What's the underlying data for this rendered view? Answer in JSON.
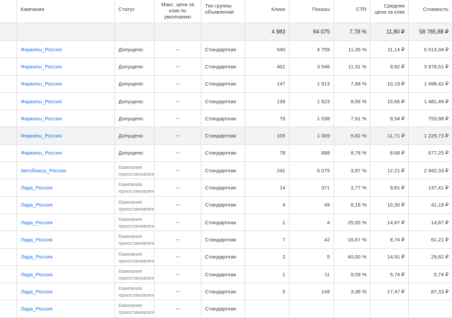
{
  "headers": {
    "campaign": "Кампания",
    "status": "Статус",
    "bid": "Макс. цена за клик по умолчанию",
    "type": "Тип группы объявлений",
    "clicks": "Клики",
    "impressions": "Показы",
    "ctr": "CTR",
    "cpc": "Средняя цена за клик",
    "cost": "Стоимость"
  },
  "totals": {
    "clicks": "4 983",
    "impressions": "64 075",
    "ctr": "7,78 %",
    "cpc": "11,80 ₽",
    "cost": "58 785,88 ₽"
  },
  "rows": [
    {
      "campaign": "Фаркопы_Россия",
      "status": "Допущено",
      "bid": "–",
      "type": "Стандартная",
      "clicks": "540",
      "impressions": "4 759",
      "ctr": "11,35 %",
      "cpc": "11,14 ₽",
      "cost": "6 013,34 ₽"
    },
    {
      "campaign": "Фаркопы_Россия",
      "status": "Допущено",
      "bid": "–",
      "type": "Стандартная",
      "clicks": "401",
      "impressions": "3 546",
      "ctr": "11,31 %",
      "cpc": "9,92 ₽",
      "cost": "3 978,51 ₽"
    },
    {
      "campaign": "Фаркопы_Россия",
      "status": "Допущено",
      "bid": "–",
      "type": "Стандартная",
      "clicks": "147",
      "impressions": "1 913",
      "ctr": "7,68 %",
      "cpc": "10,19 ₽",
      "cost": "1 498,42 ₽"
    },
    {
      "campaign": "Фаркопы_Россия",
      "status": "Допущено",
      "bid": "–",
      "type": "Стандартная",
      "clicks": "139",
      "impressions": "1 623",
      "ctr": "8,56 %",
      "cpc": "10,66 ₽",
      "cost": "1 481,48 ₽"
    },
    {
      "campaign": "Фаркопы_Россия",
      "status": "Допущено",
      "bid": "–",
      "type": "Стандартная",
      "clicks": "79",
      "impressions": "1 038",
      "ctr": "7,61 %",
      "cpc": "9,54 ₽",
      "cost": "753,98 ₽"
    },
    {
      "campaign": "Фаркопы_Россия",
      "status": "Допущено",
      "bid": "–",
      "type": "Стандартная",
      "clicks": "105",
      "impressions": "1 069",
      "ctr": "9,82 %",
      "cpc": "11,71 ₽",
      "cost": "1 229,73 ₽"
    },
    {
      "campaign": "Фаркопы_Россия",
      "status": "Допущено",
      "bid": "–",
      "type": "Стандартная",
      "clicks": "78",
      "impressions": "888",
      "ctr": "8,78 %",
      "cpc": "8,68 ₽",
      "cost": "677,25 ₽"
    },
    {
      "campaign": "Автобоксы_Россия",
      "status": "Кампания приостановлена",
      "bid": "–",
      "type": "Стандартная",
      "clicks": "241",
      "impressions": "6 075",
      "ctr": "3,97 %",
      "cpc": "12,21 ₽",
      "cost": "2 942,33 ₽"
    },
    {
      "campaign": "Лада_Россия",
      "status": "Кампания приостановлена",
      "bid": "–",
      "type": "Стандартная",
      "clicks": "14",
      "impressions": "371",
      "ctr": "3,77 %",
      "cpc": "9,81 ₽",
      "cost": "137,41 ₽"
    },
    {
      "campaign": "Лада_Россия",
      "status": "Кампания приостановлена",
      "bid": "–",
      "type": "Стандартная",
      "clicks": "4",
      "impressions": "49",
      "ctr": "8,16 %",
      "cpc": "10,30 ₽",
      "cost": "41,19 ₽"
    },
    {
      "campaign": "Лада_Россия",
      "status": "Кампания приостановлена",
      "bid": "–",
      "type": "Стандартная",
      "clicks": "1",
      "impressions": "4",
      "ctr": "25,00 %",
      "cpc": "14,87 ₽",
      "cost": "14,87 ₽"
    },
    {
      "campaign": "Лада_Россия",
      "status": "Кампания приостановлена",
      "bid": "–",
      "type": "Стандартная",
      "clicks": "7",
      "impressions": "42",
      "ctr": "16,67 %",
      "cpc": "8,74 ₽",
      "cost": "61,21 ₽"
    },
    {
      "campaign": "Лада_Россия",
      "status": "Кампания приостановлена",
      "bid": "–",
      "type": "Стандартная",
      "clicks": "2",
      "impressions": "5",
      "ctr": "40,00 %",
      "cpc": "14,91 ₽",
      "cost": "29,82 ₽"
    },
    {
      "campaign": "Лада_Россия",
      "status": "Кампания приостановлена",
      "bid": "–",
      "type": "Стандартная",
      "clicks": "1",
      "impressions": "11",
      "ctr": "9,09 %",
      "cpc": "5,74 ₽",
      "cost": "5,74 ₽"
    },
    {
      "campaign": "Лада_Россия",
      "status": "Кампания приостановлена",
      "bid": "–",
      "type": "Стандартная",
      "clicks": "5",
      "impressions": "149",
      "ctr": "3,36 %",
      "cpc": "17,47 ₽",
      "cost": "87,33 ₽"
    },
    {
      "campaign": "Лада_Россия",
      "status": "Кампания приостановлена",
      "bid": "–",
      "type": "Стандартная",
      "clicks": "",
      "impressions": "",
      "ctr": "",
      "cpc": "",
      "cost": ""
    }
  ]
}
